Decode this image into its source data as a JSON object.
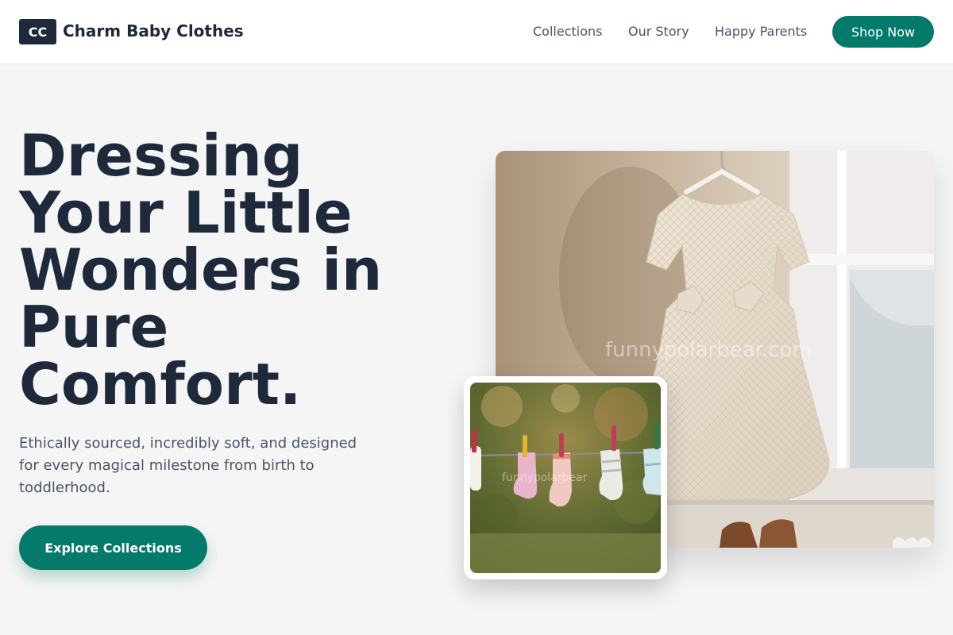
{
  "brand": {
    "badge": "CC",
    "name": "Charm Baby Clothes"
  },
  "nav": {
    "links": [
      "Collections",
      "Our Story",
      "Happy Parents"
    ],
    "cta": "Shop Now"
  },
  "hero": {
    "title": "Dressing Your Little Wonders in Pure Comfort.",
    "subtitle": "Ethically sourced, incredibly soft, and designed for every magical milestone from birth to toddlerhood.",
    "button": "Explore Collections"
  },
  "images": {
    "main_watermark": "funnypolarbear.com",
    "small_watermark": "funnypolarbear"
  },
  "colors": {
    "accent": "#047a6a",
    "heading": "#1e293b",
    "text": "#475569",
    "background": "#f5f5f5"
  }
}
